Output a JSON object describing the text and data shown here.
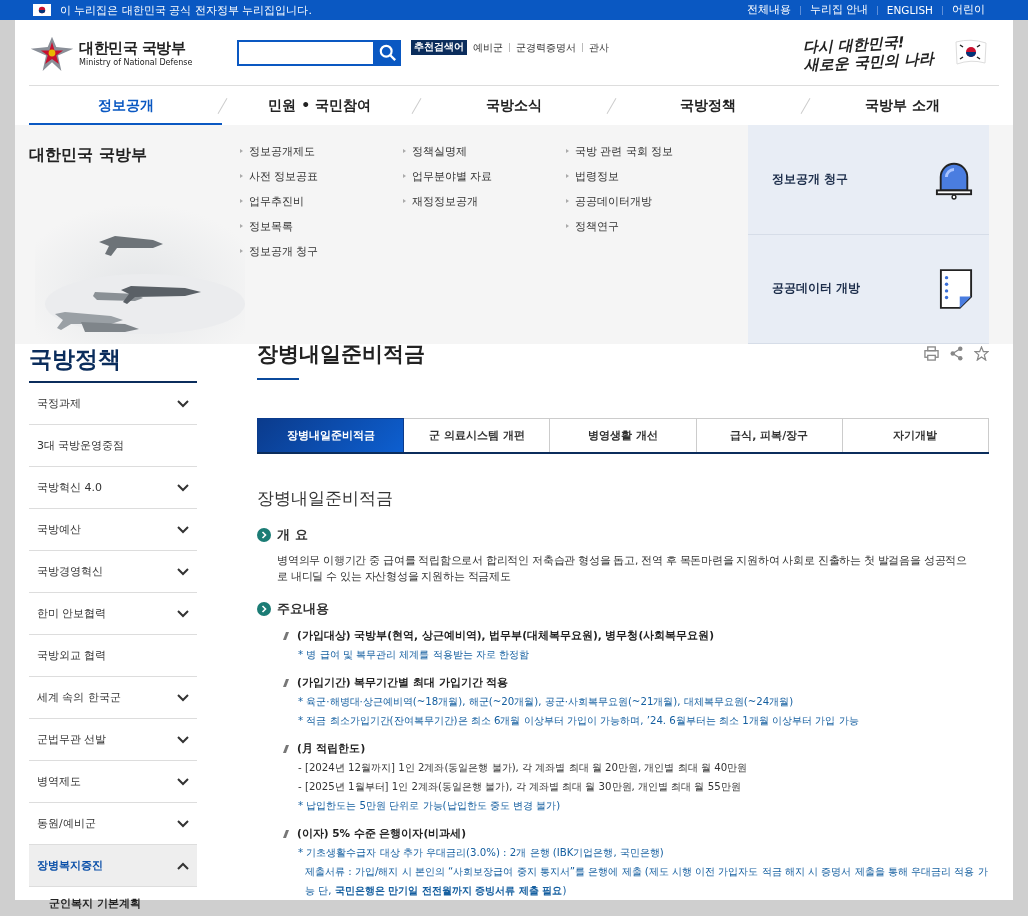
{
  "top_bar": {
    "notice": "이 누리집은 대한민국 공식 전자정부 누리집입니다.",
    "links": [
      "전체내용",
      "누리집 안내",
      "ENGLISH",
      "어린이"
    ]
  },
  "header": {
    "logo": {
      "name": "대한민국 국방부",
      "subtitle": "Ministry of National Defense"
    },
    "search": {
      "badge": "추천검색어",
      "keywords": [
        "예비군",
        "군경력증명서",
        "관사"
      ]
    },
    "slogan": [
      "다시 대한민국!",
      "새로운 국민의 나라"
    ]
  },
  "nav": [
    {
      "label": "정보공개",
      "selected": true
    },
    {
      "label": "민원 • 국민참여",
      "selected": false
    },
    {
      "label": "국방소식",
      "selected": false
    },
    {
      "label": "국방정책",
      "selected": false
    },
    {
      "label": "국방부 소개",
      "selected": false
    }
  ],
  "mega_menu": {
    "title": "대한민국 국방부",
    "columns": [
      [
        "정보공개제도",
        "사전 정보공표",
        "업무추진비",
        "정보목록",
        "정보공개 청구"
      ],
      [
        "정책실명제",
        "업무분야별 자료",
        "재정정보공개"
      ],
      [
        "국방 관련 국회 정보",
        "법령정보",
        "공공데이터개방",
        "정책연구"
      ]
    ],
    "cards": [
      {
        "label": "정보공개 청구",
        "kind": "siren"
      },
      {
        "label": "공공데이터 개방",
        "kind": "document"
      }
    ]
  },
  "sidebar": {
    "title": "국방정책",
    "items": [
      {
        "label": "국정과제",
        "kind": "toggle",
        "expanded": false
      },
      {
        "label": "3대 국방운영중점",
        "kind": "link"
      },
      {
        "label": "국방혁신 4.0",
        "kind": "toggle",
        "expanded": false
      },
      {
        "label": "국방예산",
        "kind": "toggle",
        "expanded": false
      },
      {
        "label": "국방경영혁신",
        "kind": "toggle",
        "expanded": false
      },
      {
        "label": "한미 안보협력",
        "kind": "toggle",
        "expanded": false
      },
      {
        "label": "국방외교 협력",
        "kind": "link"
      },
      {
        "label": "세계 속의 한국군",
        "kind": "toggle",
        "expanded": false
      },
      {
        "label": "군법무관 선발",
        "kind": "toggle",
        "expanded": false
      },
      {
        "label": "병역제도",
        "kind": "toggle",
        "expanded": false
      },
      {
        "label": "동원/예비군",
        "kind": "toggle",
        "expanded": false
      },
      {
        "label": "장병복지증진",
        "kind": "toggle",
        "expanded": true,
        "children": [
          {
            "label": "군인복지 기본계획"
          }
        ]
      }
    ]
  },
  "main": {
    "title": "장병내일준비적금",
    "tabs": [
      {
        "label": "장병내일준비적금",
        "selected": true
      },
      {
        "label": "군 의료시스템 개편",
        "selected": false
      },
      {
        "label": "병영생활 개선",
        "selected": false
      },
      {
        "label": "급식, 피복/장구",
        "selected": false
      },
      {
        "label": "자기개발",
        "selected": false
      }
    ],
    "heading": "장병내일준비적금",
    "sections": [
      {
        "title": "개 요",
        "kind": "text",
        "text": "병역의무 이행기간 중 급여를 적립함으로서 합리적인 저축습관 형성을 돕고, 전역 후 목돈마련을 지원하여 사회로 진출하는 첫 발걸음을 성공적으로 내디딜 수 있는 자산형성을 지원하는 적금제도"
      },
      {
        "title": "주요내용",
        "kind": "list",
        "items": [
          {
            "heading": "(가입대상) 국방부(현역, 상근예비역), 법무부(대체복무요원), 병무청(사회복무요원)",
            "lines": [
              {
                "kind": "note",
                "text": "* 병 급여 및 복무관리 체계를 적용받는 자로 한정함"
              }
            ]
          },
          {
            "heading": "(가입기간) 복무기간별 최대 가입기간 적용",
            "lines": [
              {
                "kind": "note",
                "text": "* 육군·해병대·상근예비역(~18개월), 해군(~20개월), 공군·사회복무요원(~21개월), 대체복무요원(~24개월)"
              },
              {
                "kind": "note",
                "text": "* 적금 최소가입기간(잔여복무기간)은 최소 6개월 이상부터 가입이 가능하며, ’24. 6월부터는 최소 1개월 이상부터 가입 가능"
              }
            ]
          },
          {
            "heading": "(月 적립한도)",
            "lines": [
              {
                "kind": "dash",
                "text": "- [2024년 12월까지] 1인 2계좌(동일은행 불가), 각 계좌별 최대 월 20만원, 개인별 최대 월 40만원"
              },
              {
                "kind": "dash",
                "text": "- [2025년 1월부터] 1인 2계좌(동일은행 불가), 각 계좌별 최대 월 30만원, 개인별 최대 월 55만원"
              },
              {
                "kind": "note",
                "text": "* 납입한도는 5만원 단위로 가능(납입한도 중도 변경 불가)"
              }
            ]
          },
          {
            "heading": "(이자) 5% 수준 은행이자(비과세)",
            "lines": [
              {
                "kind": "note",
                "text": "* 기초생활수급자 대상 추가 우대금리(3.0%) : 2개 은행 (IBK기업은행, 국민은행)"
              },
              {
                "kind": "indent",
                "text": "제출서류 : 가입/해지 시 본인의 “사회보장급여 중지 통지서”를 은행에 제출 (제도 시행 이전 가입자도 적금 해지 시 증명서 제출을 통해 우대금리 적용 가능 단, **국민은행은 만기일 전전월까지 증빙서류 제출 필요**)"
              }
            ]
          }
        ]
      }
    ]
  }
}
